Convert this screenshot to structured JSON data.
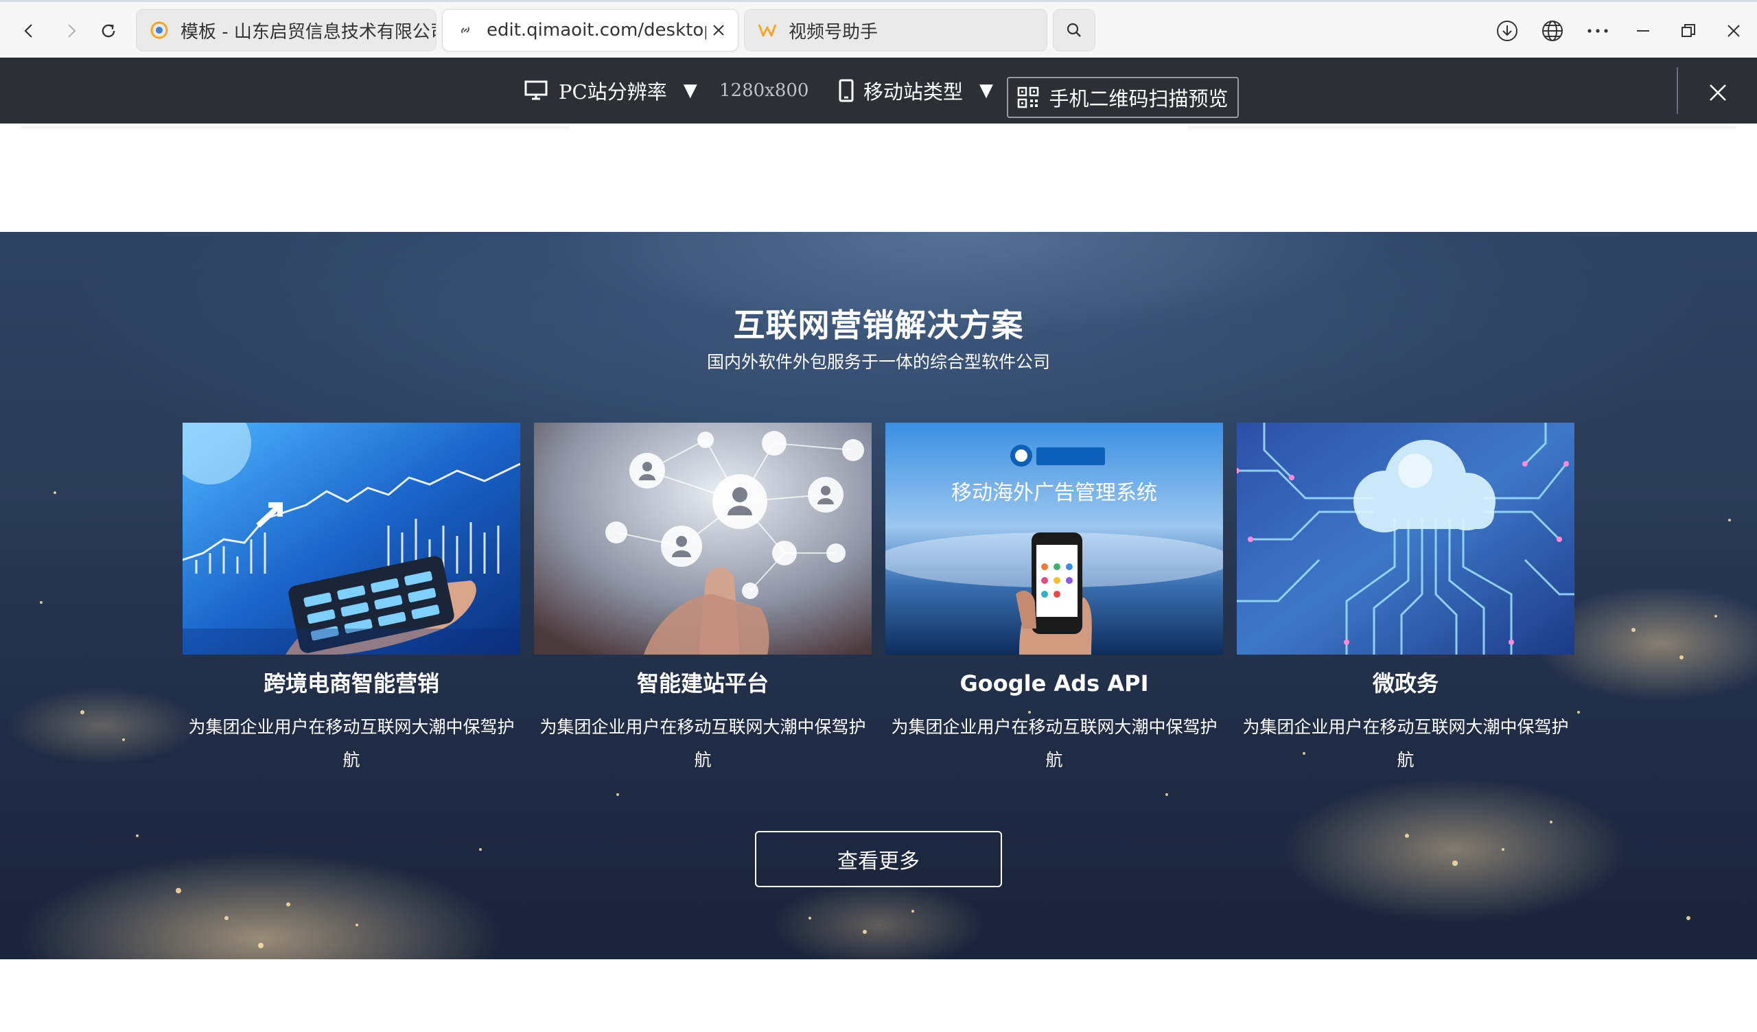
{
  "browser": {
    "tabs": [
      {
        "title": "模板 - 山东启贸信息技术有限公司",
        "active": false
      },
      {
        "title": "edit.qimaoit.com/desktop/h",
        "active": true
      },
      {
        "title": "视频号助手",
        "active": false
      }
    ]
  },
  "preview_bar": {
    "pc_label": "PC站分辨率",
    "resolution": "1280x800",
    "mobile_label": "移动站类型",
    "qr_label": "手机二维码扫描预览",
    "caret": "▼"
  },
  "hero": {
    "title": "互联网营销解决方案",
    "subtitle": "国内外软件外包服务于一体的综合型软件公司",
    "cards": [
      {
        "title": "跨境电商智能营销",
        "desc": "为集团企业用户在移动互联网大潮中保驾护航"
      },
      {
        "title": "智能建站平台",
        "desc": "为集团企业用户在移动互联网大潮中保驾护航"
      },
      {
        "title": "Google Ads API",
        "desc": "为集团企业用户在移动互联网大潮中保驾护航",
        "image_caption": "移动海外广告管理系统"
      },
      {
        "title": "微政务",
        "desc": "为集团企业用户在移动互联网大潮中保驾护航"
      }
    ],
    "more_button": "查看更多"
  },
  "colors": {
    "toolbar_bg": "#2d2f36",
    "hero_bg": "#2a3b58",
    "text_on_dark": "#ffffff"
  }
}
